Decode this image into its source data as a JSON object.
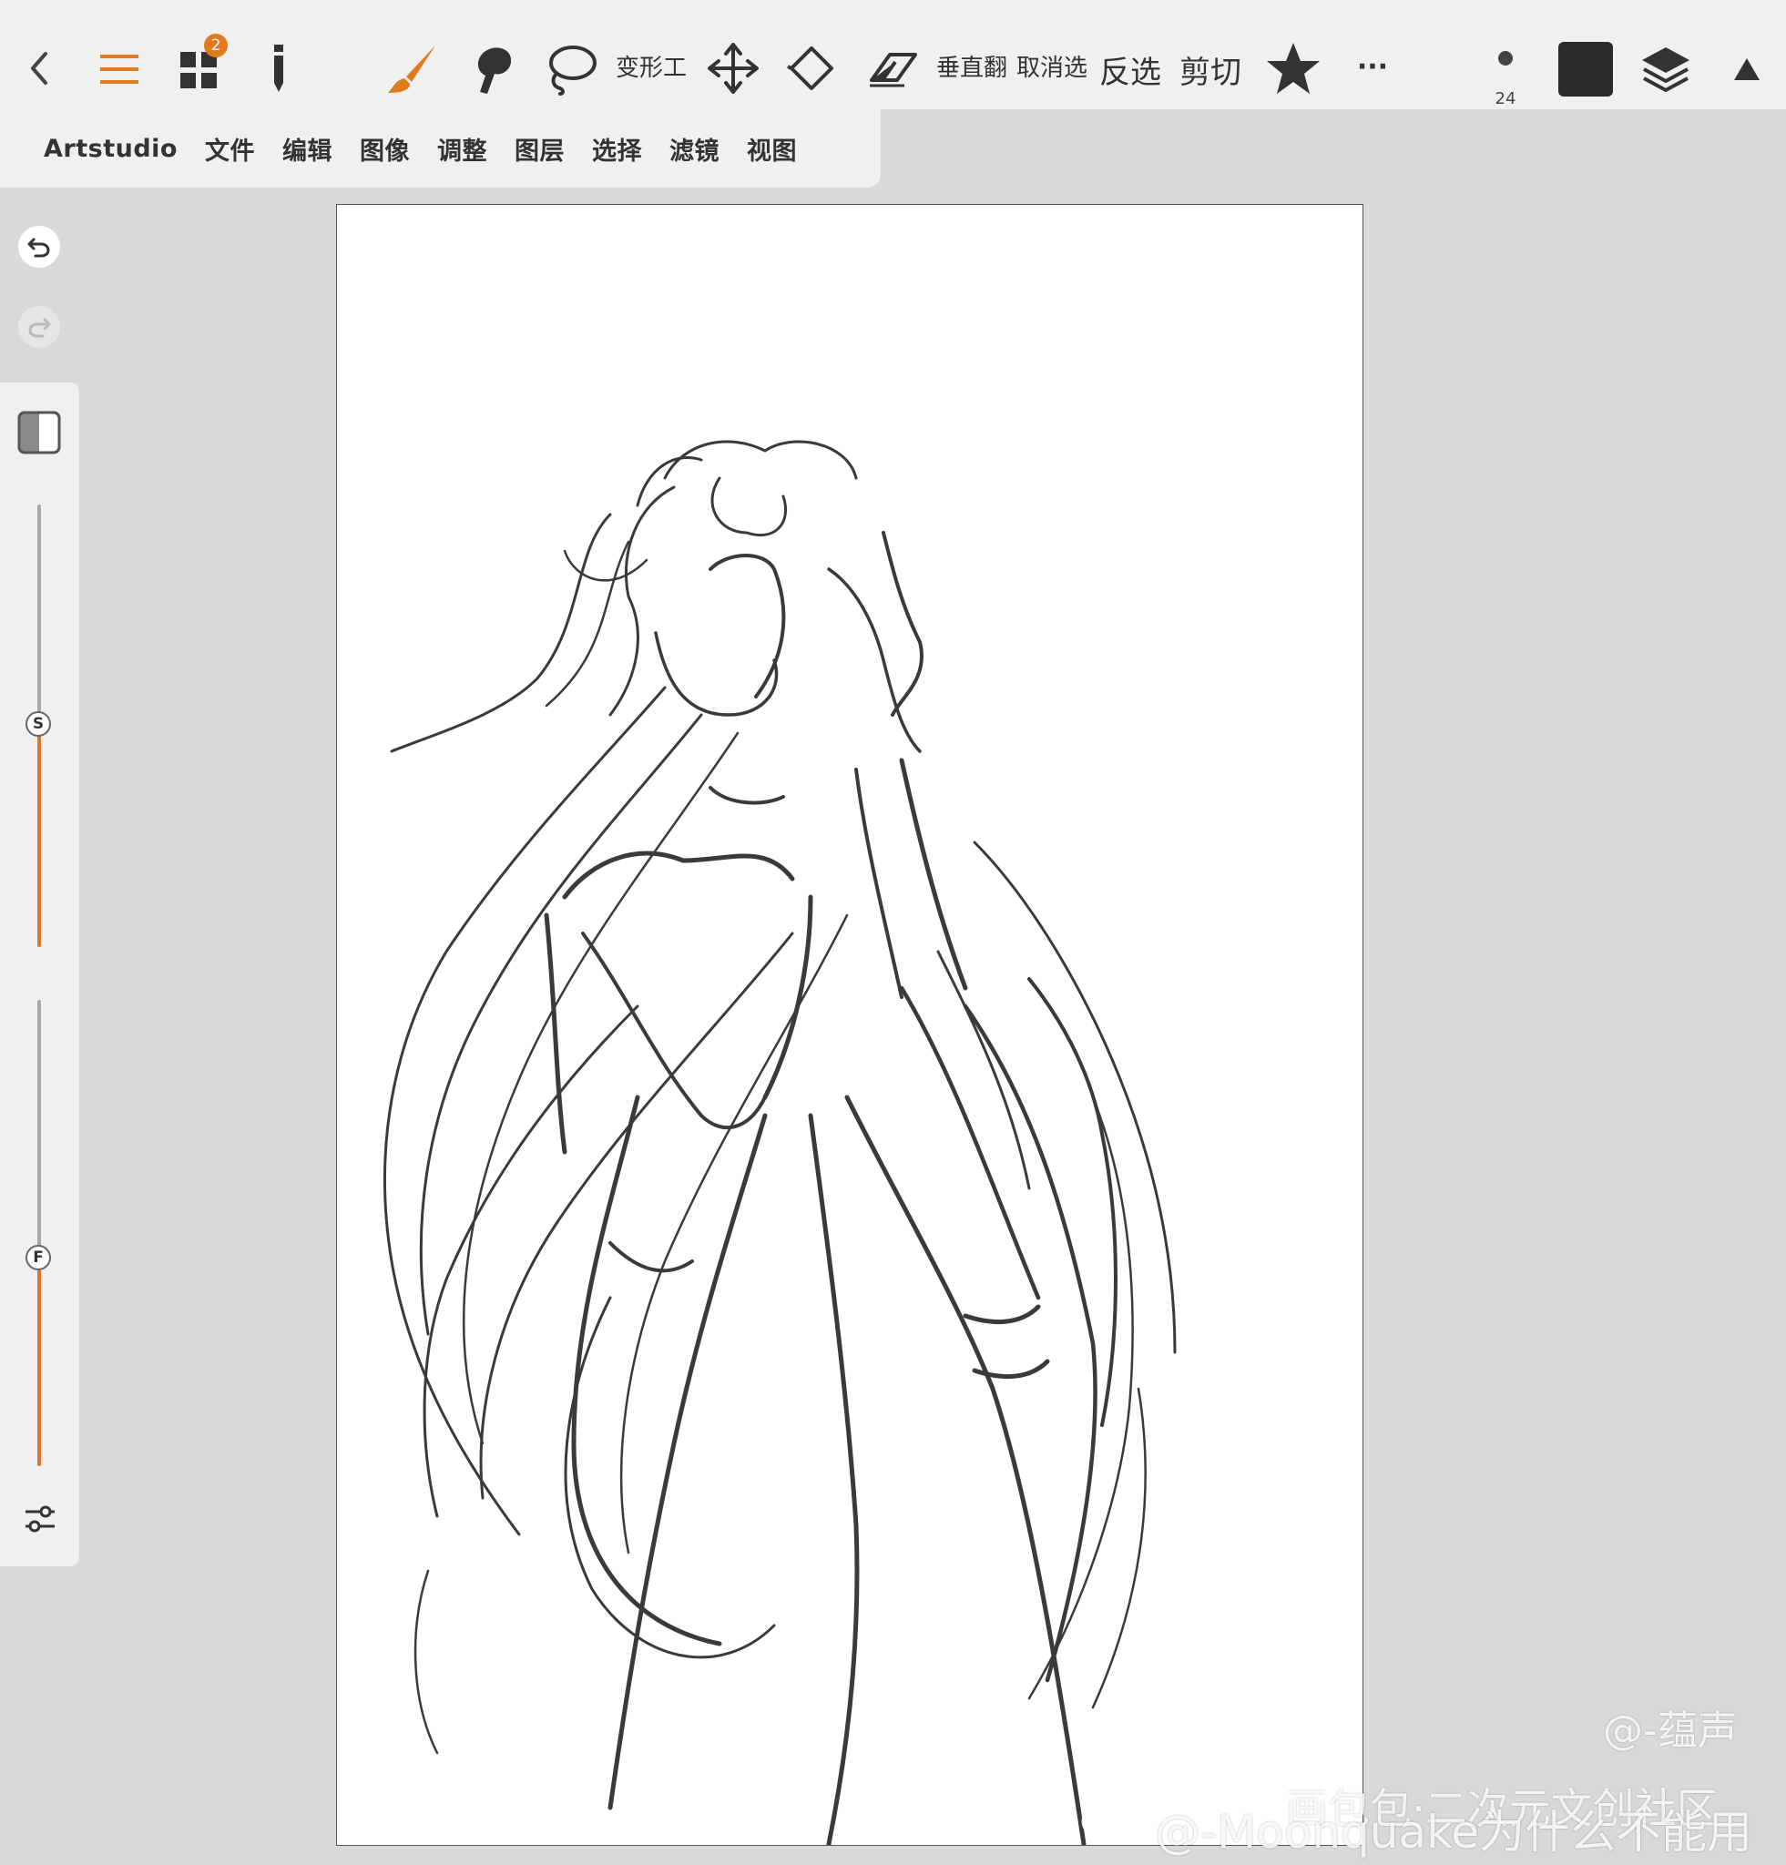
{
  "toolbar": {
    "notification_count": "2",
    "transform_label": "变形工",
    "flip_vertical_label": "垂直翻",
    "deselect_label": "取消选",
    "invert_label": "反选",
    "cut_label": "剪切",
    "more_label": "···",
    "brush_size": "24",
    "current_color": "#2a2a2a",
    "accent_color": "#e07a1f"
  },
  "menu": {
    "app_name": "Artstudio",
    "items": [
      "文件",
      "编辑",
      "图像",
      "调整",
      "图层",
      "选择",
      "滤镜",
      "视图"
    ]
  },
  "sidebar": {
    "size_knob_label": "S",
    "flow_knob_label": "F",
    "size_level_percent": 50,
    "flow_level_percent": 42
  },
  "watermarks": {
    "author": "@-蕴声",
    "community": "画包包·二次元文创社区",
    "weibo_handle": "@-Moonquake为什么不能用"
  }
}
